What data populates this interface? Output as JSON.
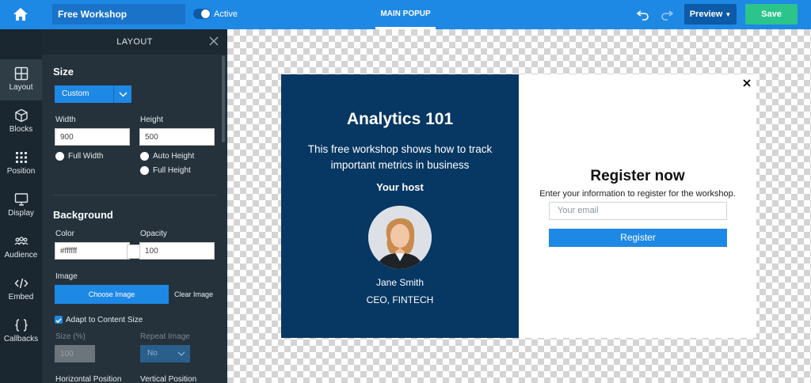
{
  "topbar": {
    "campaign_name": "Free Workshop",
    "active_label": "Active",
    "main_tab": "MAIN POPUP",
    "preview_label": "Preview",
    "save_label": "Save"
  },
  "rail": {
    "items": [
      {
        "label": "Layout",
        "icon": "layout-icon"
      },
      {
        "label": "Blocks",
        "icon": "cube-icon"
      },
      {
        "label": "Position",
        "icon": "grid-icon"
      },
      {
        "label": "Display",
        "icon": "monitor-icon"
      },
      {
        "label": "Audience",
        "icon": "users-icon"
      },
      {
        "label": "Embed",
        "icon": "code-icon"
      },
      {
        "label": "Callbacks",
        "icon": "braces-icon"
      }
    ]
  },
  "panel": {
    "header": "LAYOUT",
    "size": {
      "title": "Size",
      "preset": "Custom",
      "width_label": "Width",
      "width_value": "900",
      "height_label": "Height",
      "height_value": "500",
      "full_width_label": "Full Width",
      "auto_height_label": "Auto Height",
      "full_height_label": "Full Height"
    },
    "background": {
      "title": "Background",
      "color_label": "Color",
      "color_value": "#ffffff",
      "opacity_label": "Opacity",
      "opacity_value": "100",
      "image_label": "Image",
      "choose_image": "Choose Image",
      "clear_image": "Clear Image",
      "adapt_label": "Adapt to Content Size",
      "size_pct_label": "Size (%)",
      "size_pct_value": "100",
      "repeat_label": "Repeat Image",
      "repeat_value": "No",
      "hpos_label": "Horizontal Position",
      "vpos_label": "Vertical Position"
    }
  },
  "popup": {
    "title": "Analytics 101",
    "subtitle": "This free workshop shows how to track important metrics in business",
    "host_heading": "Your host",
    "host_name": "Jane Smith",
    "host_role": "CEO, FINTECH",
    "register_title": "Register now",
    "register_sub": "Enter your information to register for the workshop.",
    "email_placeholder": "Your email",
    "register_button": "Register"
  },
  "colors": {
    "accent": "#1e88e5",
    "save": "#2bc48b",
    "popup_left": "#073763"
  }
}
